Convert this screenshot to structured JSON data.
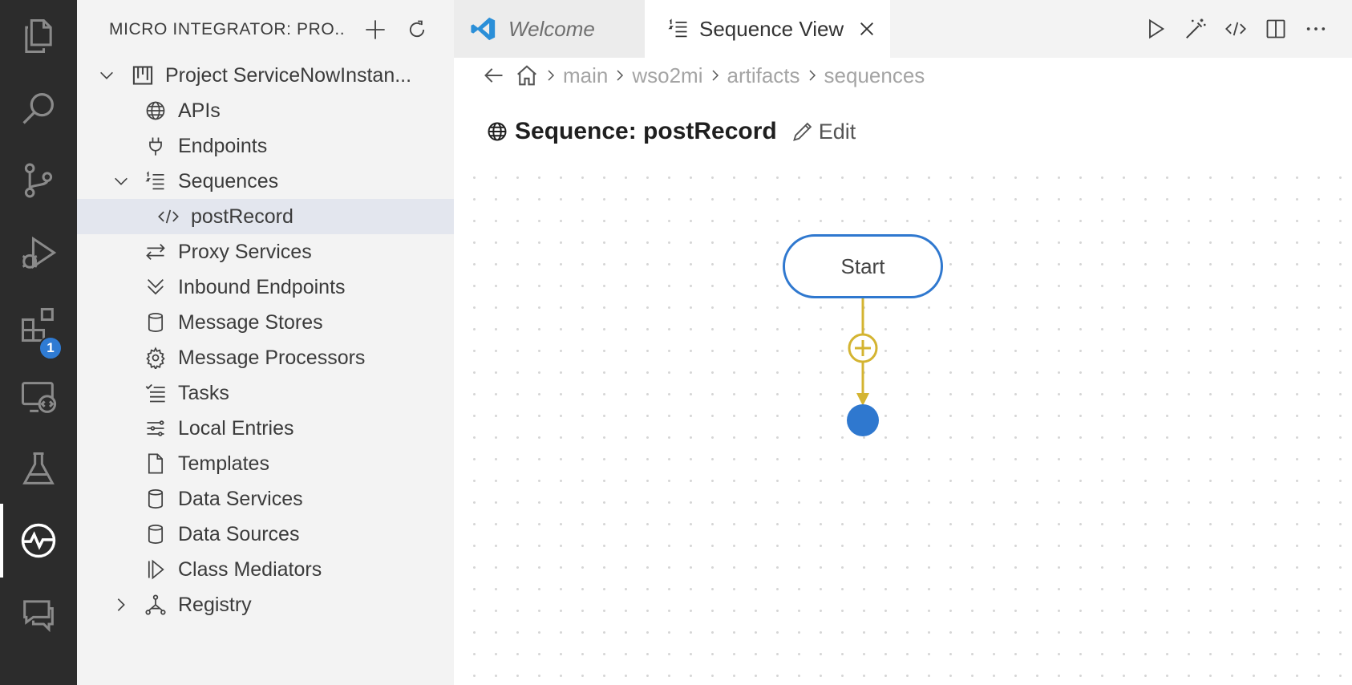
{
  "activity_bar": {
    "items": [
      "explorer-icon",
      "search-icon",
      "source-control-icon",
      "run-debug-icon",
      "extensions-icon",
      "remote-explorer-icon",
      "testing-icon",
      "micro-integrator-icon",
      "chat-icon"
    ],
    "extensions_badge": "1"
  },
  "sidebar": {
    "title": "MICRO INTEGRATOR: PRO...",
    "project": "Project ServiceNowInstan...",
    "items": {
      "apis": "APIs",
      "endpoints": "Endpoints",
      "sequences": "Sequences",
      "post_record": "postRecord",
      "proxy_services": "Proxy Services",
      "inbound_endpoints": "Inbound Endpoints",
      "message_stores": "Message Stores",
      "message_processors": "Message Processors",
      "tasks": "Tasks",
      "local_entries": "Local Entries",
      "templates": "Templates",
      "data_services": "Data Services",
      "data_sources": "Data Sources",
      "class_mediators": "Class Mediators",
      "registry": "Registry"
    }
  },
  "tabs": {
    "welcome": "Welcome",
    "sequence_view": "Sequence View"
  },
  "breadcrumb": [
    "main",
    "wso2mi",
    "artifacts",
    "sequences"
  ],
  "sequence": {
    "title": "Sequence: postRecord",
    "edit_label": "Edit",
    "start_node": "Start"
  },
  "colors": {
    "accent": "#2f78cf",
    "flow_line": "#d4b431",
    "activity_bar": "#2c2c2c",
    "sidebar_bg": "#f3f3f3",
    "selection_bg": "#e3e6ee"
  }
}
